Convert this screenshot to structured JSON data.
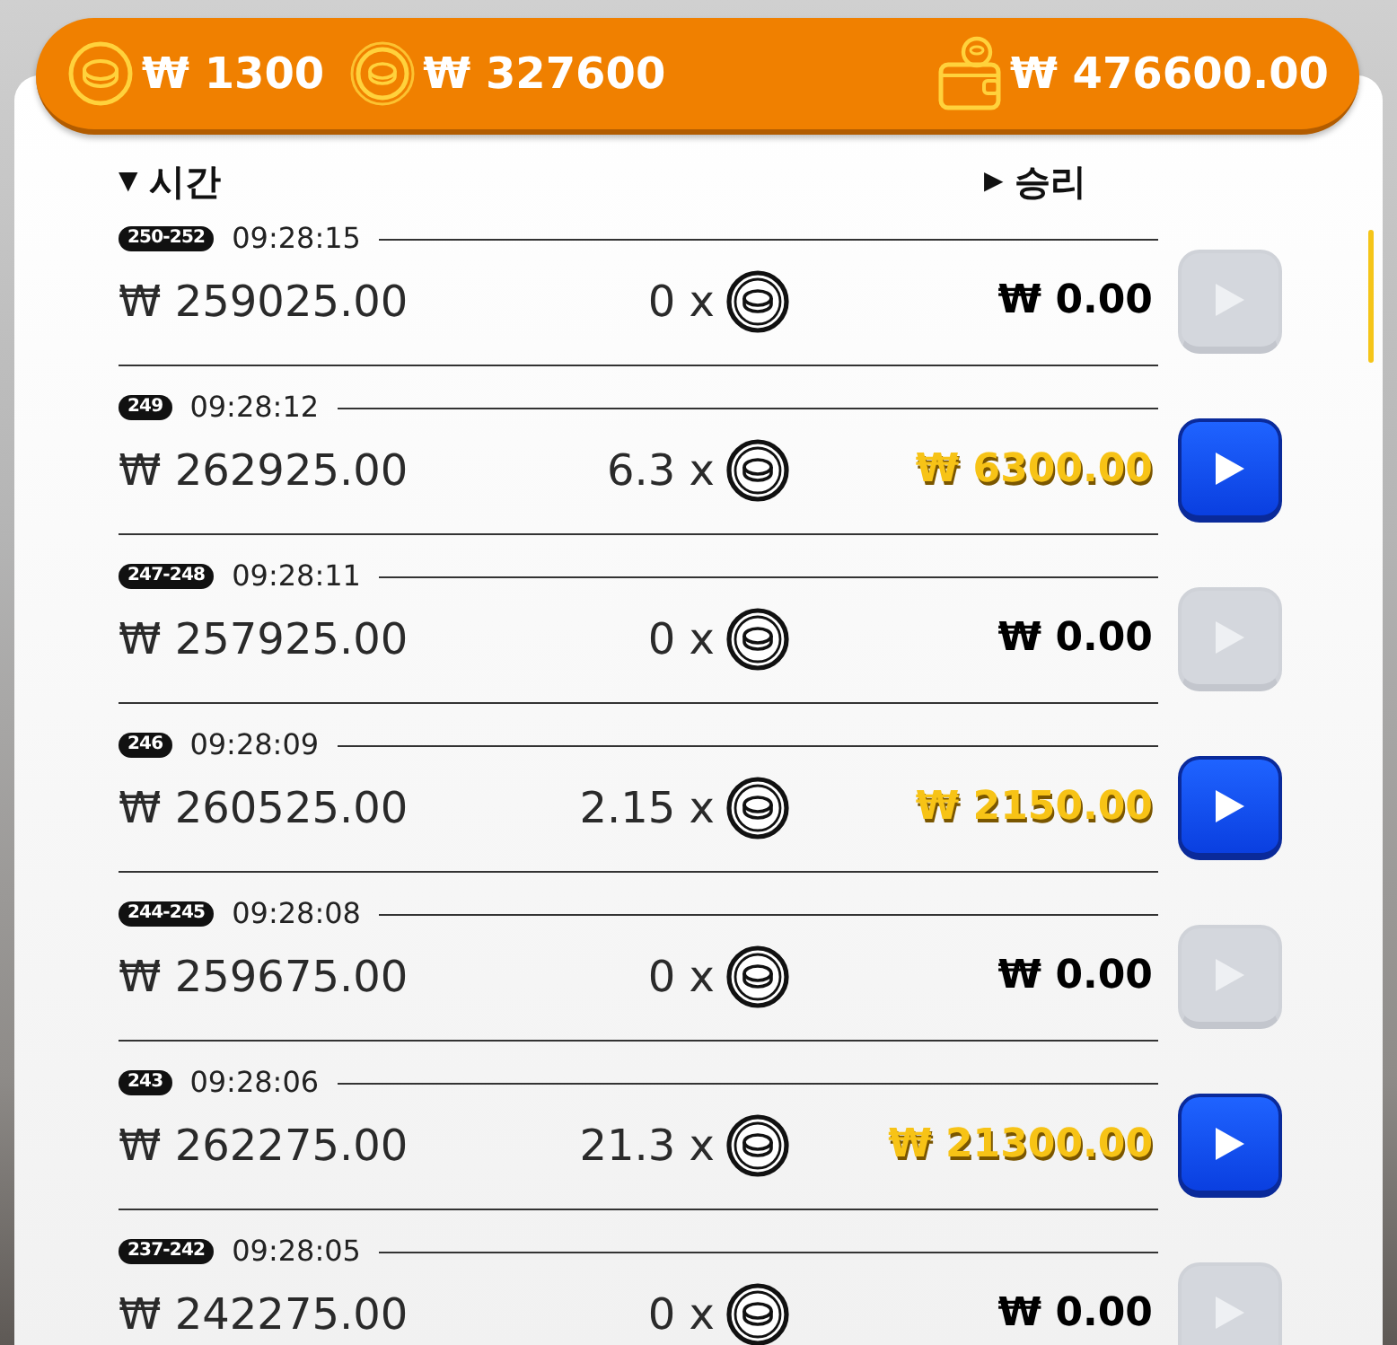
{
  "balance_bar": [
    {
      "kind": "coin",
      "amount": "₩ 1300"
    },
    {
      "kind": "bonus_coin",
      "amount": "₩ 327600"
    },
    {
      "kind": "wallet",
      "amount": "₩ 476600.00"
    }
  ],
  "columns": [
    {
      "marker": "▼",
      "label": "시간"
    },
    {
      "marker": "▶",
      "label": "승리"
    }
  ],
  "rounds": [
    {
      "round": "250-252",
      "time": "09:28:15",
      "bet": "₩ 259025.00",
      "multiplier": "0 x",
      "win": "₩ 0.00",
      "won": false
    },
    {
      "round": "249",
      "time": "09:28:12",
      "bet": "₩ 262925.00",
      "multiplier": "6.3 x",
      "win": "₩ 6300.00",
      "won": true
    },
    {
      "round": "247-248",
      "time": "09:28:11",
      "bet": "₩ 257925.00",
      "multiplier": "0 x",
      "win": "₩ 0.00",
      "won": false
    },
    {
      "round": "246",
      "time": "09:28:09",
      "bet": "₩ 260525.00",
      "multiplier": "2.15 x",
      "win": "₩ 2150.00",
      "won": true
    },
    {
      "round": "244-245",
      "time": "09:28:08",
      "bet": "₩ 259675.00",
      "multiplier": "0 x",
      "win": "₩ 0.00",
      "won": false
    },
    {
      "round": "243",
      "time": "09:28:06",
      "bet": "₩ 262275.00",
      "multiplier": "21.3 x",
      "win": "₩ 21300.00",
      "won": true
    },
    {
      "round": "237-242",
      "time": "09:28:05",
      "bet": "₩ 242275.00",
      "multiplier": "0 x",
      "win": "₩ 0.00",
      "won": false
    }
  ]
}
